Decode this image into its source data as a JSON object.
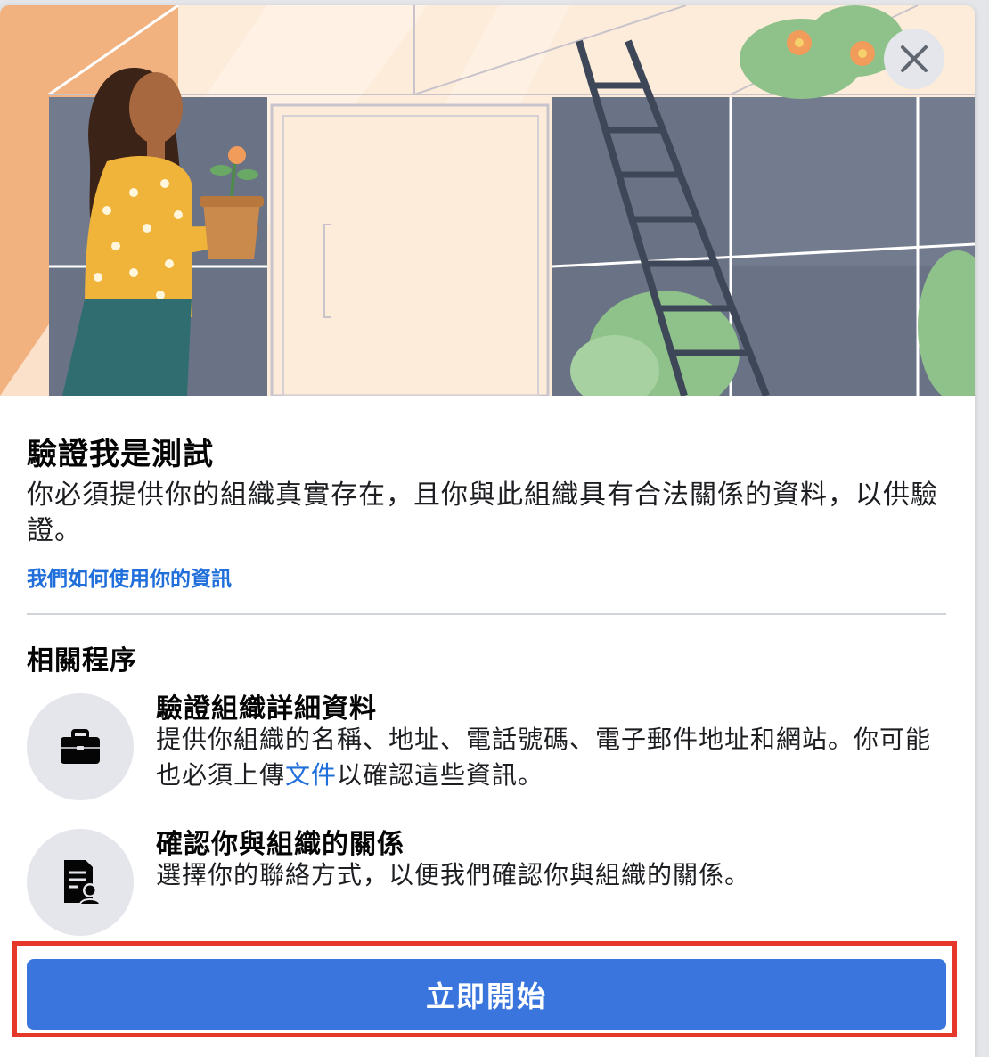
{
  "dialog": {
    "title": "驗證我是測試",
    "description": "你必須提供你的組織真實存在，且你與此組織具有合法關係的資料，以供驗證。",
    "info_link": "我們如何使用你的資訊"
  },
  "section": {
    "title": "相關程序"
  },
  "steps": [
    {
      "title": "驗證組織詳細資料",
      "desc_before": "提供你組織的名稱、地址、電話號碼、電子郵件地址和網站。你可能也必須上傳",
      "desc_link": "文件",
      "desc_after": "以確認這些資訊。",
      "icon": "briefcase-icon"
    },
    {
      "title": "確認你與組織的關係",
      "desc": "選擇你的聯絡方式，以便我們確認你與組織的關係。",
      "icon": "contact-document-icon"
    }
  ],
  "cta": {
    "label": "立即開始"
  },
  "colors": {
    "accent": "#3a75de",
    "link": "#216fdb",
    "highlight": "#e5382a"
  }
}
